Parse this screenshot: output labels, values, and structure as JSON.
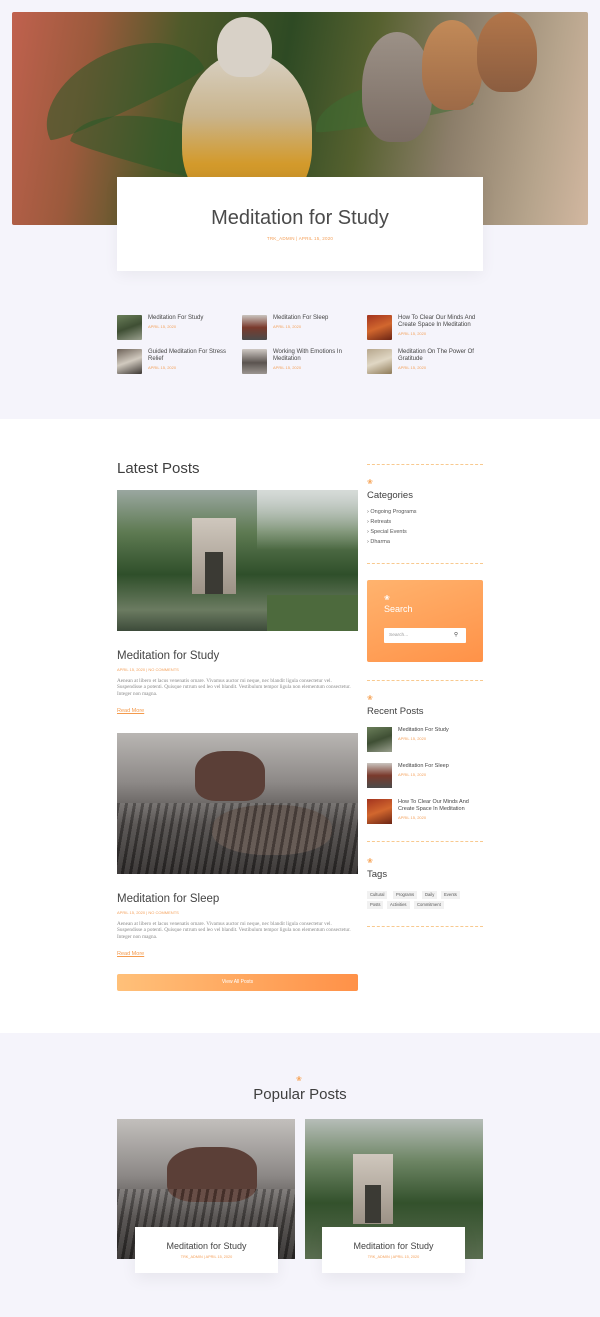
{
  "hero": {
    "title": "Meditation for Study",
    "meta": "TRK_ADMIN | APRIL 15, 2020"
  },
  "related": [
    {
      "title": "Meditation For Study",
      "date": "APRIL 15, 2020"
    },
    {
      "title": "Meditation For Sleep",
      "date": "APRIL 15, 2020"
    },
    {
      "title": "How To Clear Our Minds And Create Space In Meditation",
      "date": "APRIL 15, 2020"
    },
    {
      "title": "Guided Meditation For Stress Relief",
      "date": "APRIL 15, 2020"
    },
    {
      "title": "Working With Emotions In Meditation",
      "date": "APRIL 15, 2020"
    },
    {
      "title": "Meditation On The Power Of Gratitude",
      "date": "APRIL 15, 2020"
    }
  ],
  "latest": {
    "heading": "Latest Posts",
    "posts": [
      {
        "title": "Meditation for Study",
        "meta": "APRIL 15, 2020 | NO COMMENTS",
        "excerpt": "Aenean at libero et lacus venenatis ornare. Vivamus auctor mi neque, nec blandit ligula consectetur vel. Suspendisse a potenti. Quisque rutrum sed leo vel blandit. Vestibulum tempor ligula non elementum consectetur. Integer non magna.",
        "read_more": "Read More"
      },
      {
        "title": "Meditation for Sleep",
        "meta": "APRIL 15, 2020 | NO COMMENTS",
        "excerpt": "Aenean at libero et lacus venenatis ornare. Vivamus auctor mi neque, nec blandit ligula consectetur vel. Suspendisse a potenti. Quisque rutrum sed leo vel blandit. Vestibulum tempor ligula non elementum consectetur. Integer non magna.",
        "read_more": "Read More"
      }
    ],
    "view_all": "View All Posts"
  },
  "sidebar": {
    "categories_heading": "Categories",
    "categories": [
      "Ongoing Programs",
      "Retreats",
      "Special Events",
      "Dharma"
    ],
    "search_heading": "Search",
    "search_placeholder": "Search...",
    "recent_heading": "Recent Posts",
    "recent": [
      {
        "title": "Meditation For Study",
        "date": "APRIL 15, 2020"
      },
      {
        "title": "Meditation For Sleep",
        "date": "APRIL 15, 2020"
      },
      {
        "title": "How To Clear Our Minds And Create Space In Meditation",
        "date": "APRIL 15, 2020"
      }
    ],
    "tags_heading": "Tags",
    "tags": [
      "Cultural",
      "Programs",
      "Daily",
      "Events",
      "Posts",
      "Activities",
      "Commitment"
    ]
  },
  "popular": {
    "heading": "Popular Posts",
    "posts": [
      {
        "title": "Meditation for Study",
        "meta": "TRK_ADMIN | APRIL 15, 2020"
      },
      {
        "title": "Meditation for Study",
        "meta": "TRK_ADMIN | APRIL 15, 2020"
      }
    ]
  },
  "colors": {
    "accent": "#f4a05a",
    "gradient_start": "#ffc079",
    "gradient_end": "#ff9148"
  },
  "icons": {
    "section": "lotus-icon",
    "search": "search-icon"
  }
}
